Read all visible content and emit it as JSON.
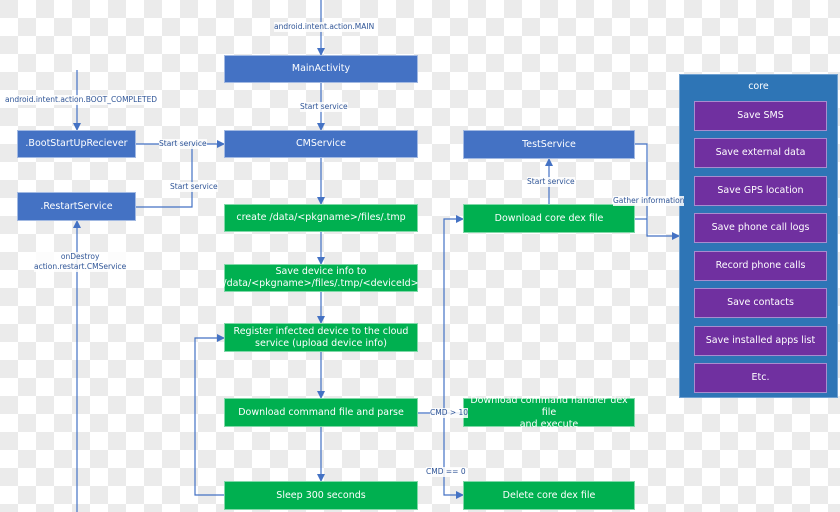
{
  "colors": {
    "blue_box": "#4472c4",
    "green_box": "#00b050",
    "purple_box": "#7030a0",
    "core_container": "#2e75b6",
    "connector": "#4472c4"
  },
  "nodes": {
    "main_activity": "MainActivity",
    "cm_service": "CMService",
    "boot_receiver": ".BootStartUpReciever",
    "restart_service": ".RestartService",
    "test_service": "TestService",
    "create_tmp": "create /data/<pkgname>/files/.tmp",
    "save_device_info_1": "Save device info to",
    "save_device_info_2": "/data/<pkgname>/files/.tmp/<deviceId>",
    "register_1": "Register infected device to the cloud",
    "register_2": "service (upload device info)",
    "download_command": "Download command file and parse",
    "sleep": "Sleep 300 seconds",
    "download_core_dex": "Download core dex file",
    "download_handler_1": "Download command handler dex file",
    "download_handler_2": "and execute",
    "delete_core_dex": "Delete core dex file"
  },
  "core": {
    "title": "core",
    "items": [
      "Save SMS",
      "Save external data",
      "Save GPS location",
      "Save phone call logs",
      "Record phone calls",
      "Save contacts",
      "Save installed apps list",
      "Etc."
    ]
  },
  "edge_labels": {
    "intent_main": "android.intent.action.MAIN",
    "boot_completed": "android.intent.action.BOOT_COMPLETED",
    "start_service_main": "Start service",
    "start_service_boot": "Start service",
    "start_service_restart": "Start service",
    "start_service_test": "Start service",
    "on_destroy_1": "onDestroy",
    "on_destroy_2": "action.restart.CMService",
    "gather_information": "Gather information",
    "cmd_gt_10": "CMD > 10",
    "cmd_eq_0": "CMD == 0"
  }
}
